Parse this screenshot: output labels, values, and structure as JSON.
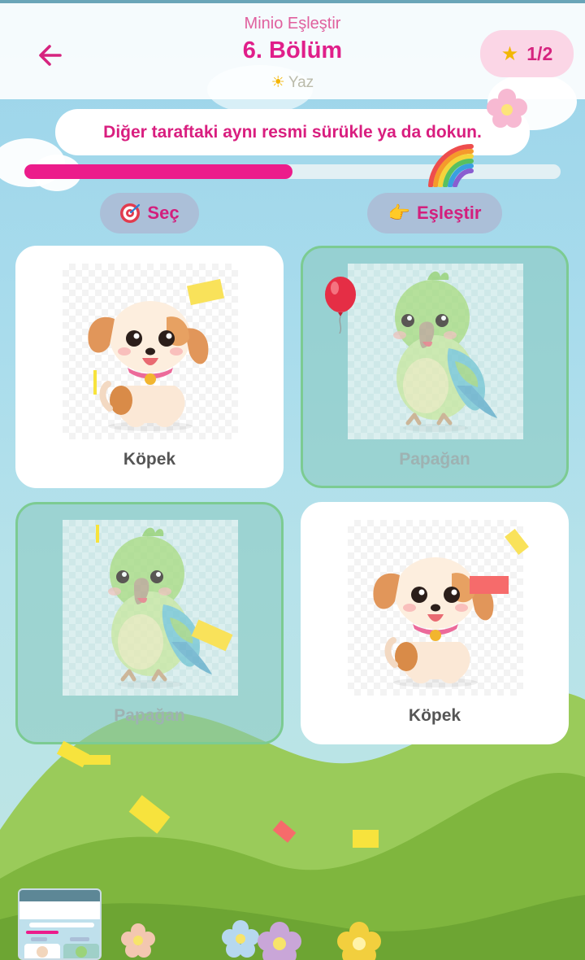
{
  "header": {
    "subtitle": "Minio Eşleştir",
    "title": "6. Bölüm",
    "season": "Yaz",
    "score": "1/2"
  },
  "instruction": "Diğer taraftaki aynı resmi sürükle ya da dokun.",
  "progress": 0.5,
  "pills": {
    "select": "Seç",
    "match": "Eşleştir"
  },
  "cards": [
    {
      "label": "Köpek",
      "animal": "dog",
      "matched": false
    },
    {
      "label": "Papağan",
      "animal": "parrot",
      "matched": true
    },
    {
      "label": "Papağan",
      "animal": "parrot",
      "matched": true
    },
    {
      "label": "Köpek",
      "animal": "dog",
      "matched": false
    }
  ],
  "colors": {
    "accent": "#e01f8a",
    "progress": "#ec1c8b",
    "matched_border": "#7ccb92",
    "star": "#f2b705"
  },
  "icons": {
    "back": "arrow-left-icon",
    "star": "star-icon",
    "sun": "sun-icon",
    "select": "target-icon",
    "match": "pointing-hand-icon"
  }
}
